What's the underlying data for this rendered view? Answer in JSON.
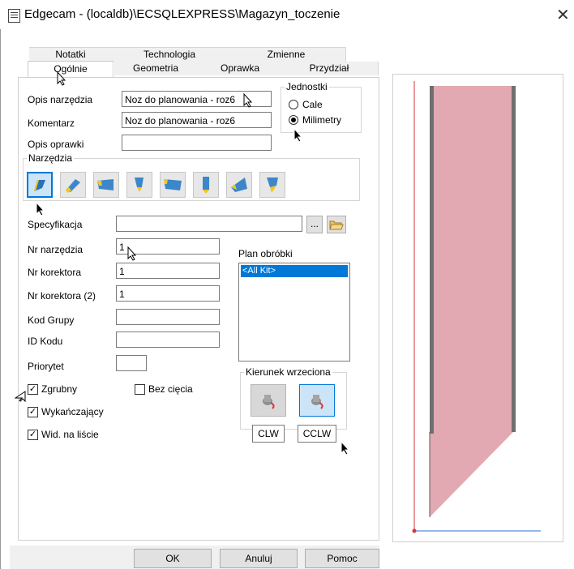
{
  "window": {
    "title": "Edgecam - (localdb)\\ECSQLEXPRESS\\Magazyn_toczenie",
    "close_glyph": "✕"
  },
  "tabs": {
    "back": [
      "Notatki",
      "Technologia",
      "Zmienne"
    ],
    "front": [
      "Ogólnie",
      "Geometria",
      "Oprawka",
      "Przydział"
    ],
    "active": "Ogólnie"
  },
  "fields_top": {
    "opis_label": "Opis narzędzia",
    "opis_value": "Noz do planowania - roz6",
    "komentarz_label": "Komentarz",
    "komentarz_value": "Noz do planowania - roz6",
    "opis_oprawki_label": "Opis oprawki",
    "opis_oprawki_value": ""
  },
  "units": {
    "legend": "Jednostki",
    "options": [
      "Cale",
      "Milimetry"
    ],
    "selected": "Milimetry"
  },
  "narzedzia": {
    "legend": "Narzędzia",
    "tools": [
      "tool-turning-icon",
      "tool-grooving-icon",
      "tool-parting-icon",
      "tool-threading-icon",
      "tool-boring-icon",
      "tool-drill-icon",
      "tool-profiling-icon",
      "tool-custom-icon"
    ],
    "selected_index": 0
  },
  "specyfikacja": {
    "label": "Specyfikacja",
    "value": "",
    "browse_label": "...",
    "folder_icon": "folder-open-icon"
  },
  "numbers": {
    "nr_narzedzia_label": "Nr narzędzia",
    "nr_narzedzia_value": "1",
    "nr_korektora_label": "Nr korektora",
    "nr_korektora_value": "1",
    "nr_korektora2_label": "Nr korektora (2)",
    "nr_korektora2_value": "1",
    "kod_grupy_label": "Kod Grupy",
    "kod_grupy_value": "",
    "id_kodu_label": "ID Kodu",
    "id_kodu_value": "",
    "priorytet_label": "Priorytet",
    "priorytet_value": ""
  },
  "plan": {
    "label": "Plan obróbki",
    "items": [
      "<All Kit>"
    ],
    "selected": "<All Kit>"
  },
  "checks": {
    "zgrubny": {
      "label": "Zgrubny",
      "checked": true
    },
    "bez_ciecia": {
      "label": "Bez cięcia",
      "checked": false
    },
    "wykanczajacy": {
      "label": "Wykańczający",
      "checked": true
    },
    "wid": {
      "label": "Wid. na liście",
      "checked": true
    }
  },
  "spindle": {
    "legend": "Kierunek wrzeciona",
    "clw_label": "CLW",
    "cclw_label": "CCLW",
    "selected": "CCLW"
  },
  "footer": {
    "ok": "OK",
    "cancel": "Anuluj",
    "help": "Pomoc"
  },
  "colors": {
    "accent": "#0078d7",
    "tool_fill": "#e2a9b2",
    "tool_edge": "#5a5a5a",
    "axis_red": "#d9323a",
    "axis_blue": "#2b6fd6"
  }
}
